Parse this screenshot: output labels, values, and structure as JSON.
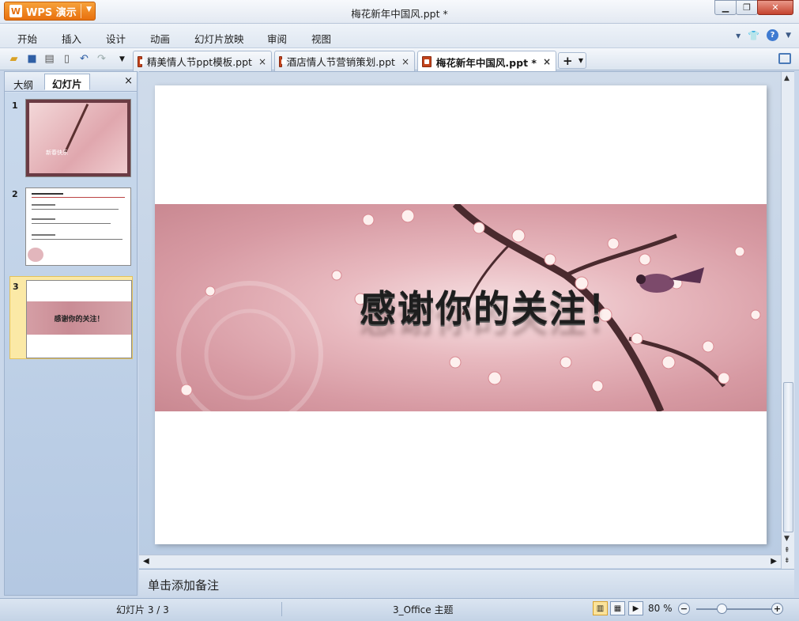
{
  "app": {
    "name": "WPS 演示",
    "logo": "W"
  },
  "window": {
    "title": "梅花新年中国风.ppt *"
  },
  "menu": {
    "items": [
      "开始",
      "插入",
      "设计",
      "动画",
      "幻灯片放映",
      "审阅",
      "视图"
    ]
  },
  "doc_tabs": [
    {
      "label": "精美情人节ppt模板.ppt",
      "close": "×"
    },
    {
      "label": "酒店情人节营销策划.ppt",
      "close": "×"
    },
    {
      "label": "梅花新年中国风.ppt *",
      "close": "×"
    }
  ],
  "add_tab": "+",
  "side_panel": {
    "tabs": [
      "大纲",
      "幻灯片"
    ],
    "close": "×",
    "slides": [
      {
        "num": "1",
        "caption": "新春快乐"
      },
      {
        "num": "2",
        "caption": ""
      },
      {
        "num": "3",
        "caption": "感谢你的关注！"
      }
    ]
  },
  "slide": {
    "title": "感谢你的关注！"
  },
  "notes": {
    "placeholder": "单击添加备注"
  },
  "status": {
    "slide_counter": "幻灯片 3 / 3",
    "theme": "3_Office 主题",
    "zoom": "80 %"
  },
  "colors": {
    "accent": "#e8700e",
    "banner": "#d79aa3"
  }
}
